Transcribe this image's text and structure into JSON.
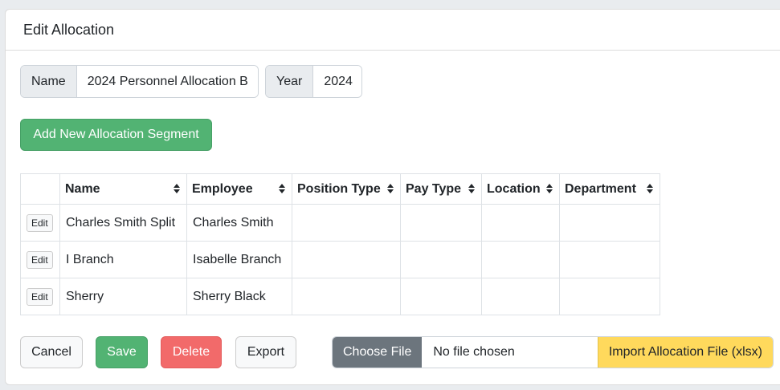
{
  "header": {
    "title": "Edit Allocation"
  },
  "form": {
    "name_label": "Name",
    "name_value": "2024 Personnel Allocation B",
    "year_label": "Year",
    "year_value": "2024"
  },
  "actions": {
    "add_segment_label": "Add New Allocation Segment"
  },
  "table": {
    "columns": [
      "",
      "Name",
      "Employee",
      "Position Type",
      "Pay Type",
      "Location",
      "Department"
    ],
    "rows": [
      {
        "edit": "Edit",
        "name": "Charles Smith Split",
        "employee": "Charles Smith",
        "position_type": "",
        "pay_type": "",
        "location": "",
        "department": ""
      },
      {
        "edit": "Edit",
        "name": "I Branch",
        "employee": "Isabelle Branch",
        "position_type": "",
        "pay_type": "",
        "location": "",
        "department": ""
      },
      {
        "edit": "Edit",
        "name": "Sherry",
        "employee": "Sherry Black",
        "position_type": "",
        "pay_type": "",
        "location": "",
        "department": ""
      }
    ]
  },
  "footer": {
    "cancel_label": "Cancel",
    "save_label": "Save",
    "delete_label": "Delete",
    "export_label": "Export",
    "choose_file_label": "Choose File",
    "file_status": "No file chosen",
    "import_label": "Import Allocation File (xlsx)"
  },
  "colors": {
    "success": "#52b373",
    "danger": "#f26a6a",
    "warning": "#ffd95c",
    "secondary": "#6c757d"
  }
}
